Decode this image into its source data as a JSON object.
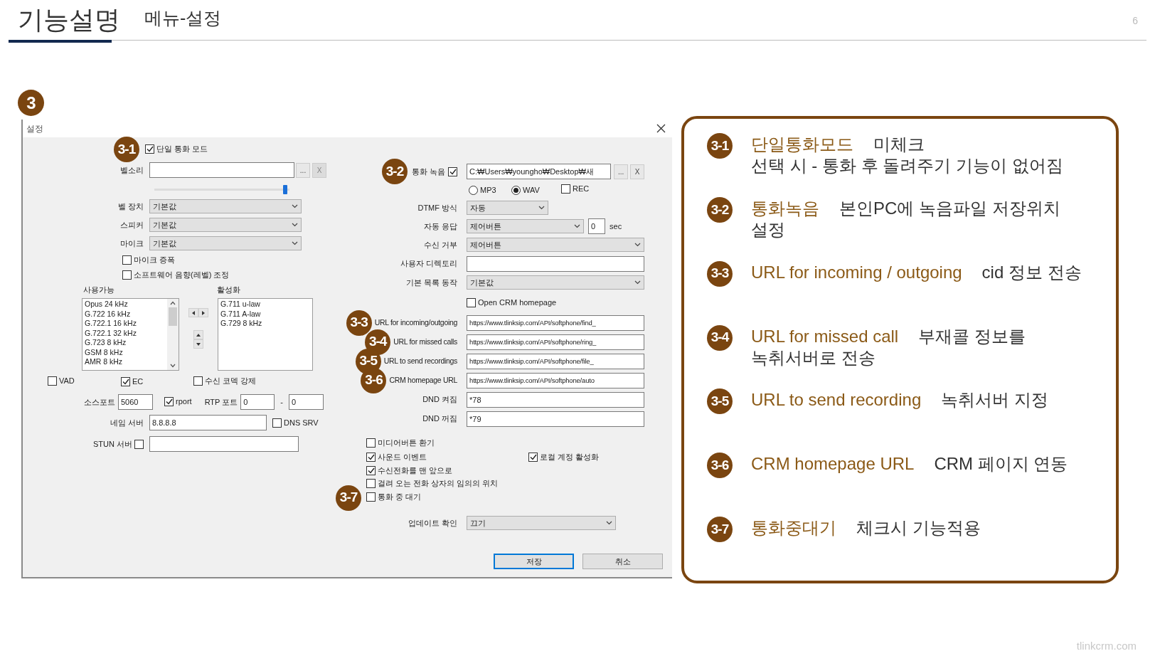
{
  "header": {
    "title": "기능설명",
    "subtitle": "메뉴-설정",
    "page_number": "6"
  },
  "section_badge": "3",
  "dialog": {
    "title": "설정",
    "single_call": {
      "badge": "3-1",
      "label": "단일 통화 모드",
      "checked": true
    },
    "ringtone": {
      "label": "벨소리",
      "browse": "...",
      "clear": "X",
      "volume": {
        "level": 0.97
      }
    },
    "devices": [
      {
        "label": "벨 장치",
        "value": "기본값"
      },
      {
        "label": "스피커",
        "value": "기본값"
      },
      {
        "label": "마이크",
        "value": "기본값"
      }
    ],
    "audio_checks": [
      {
        "label": "마이크 증폭",
        "checked": false
      },
      {
        "label": "소프트웨어 음향(레벨) 조정",
        "checked": false
      }
    ],
    "codecs": {
      "available_label": "사용가능",
      "available": [
        "Opus 24 kHz",
        "G.722 16 kHz",
        "G.722.1 16 kHz",
        "G.722.1 32 kHz",
        "G.723 8 kHz",
        "GSM 8 kHz",
        "AMR 8 kHz"
      ],
      "active_label": "활성화",
      "active": [
        "G.711 u-law",
        "G.711 A-law",
        "G.729 8 kHz"
      ]
    },
    "codec_options": [
      {
        "label": "VAD",
        "checked": false
      },
      {
        "label": "EC",
        "checked": true
      },
      {
        "label": "수신 코덱 강제",
        "checked": false
      }
    ],
    "source_port": {
      "label": "소스포트",
      "value": "5060"
    },
    "rport": {
      "label": "rport",
      "checked": true
    },
    "rtp_port": {
      "label": "RTP 포트",
      "from": "0",
      "separator": "-",
      "to": "0"
    },
    "name_server": {
      "label": "네임 서버",
      "value": "8.8.8.8"
    },
    "dns_srv": {
      "label": "DNS SRV",
      "checked": false
    },
    "stun_server": {
      "label": "STUN 서버",
      "checked": false
    },
    "recording": {
      "badge": "3-2",
      "label": "통화 녹음",
      "checked": true,
      "path": "C:₩Users₩youngho₩Desktop₩새",
      "browse": "...",
      "clear": "X"
    },
    "formats": [
      {
        "label": "MP3",
        "selected": false
      },
      {
        "label": "WAV",
        "selected": true
      }
    ],
    "rec": {
      "label": "REC",
      "checked": false
    },
    "dtmf": {
      "label": "DTMF 방식",
      "value": "자동"
    },
    "auto_answer": {
      "label": "자동 응답",
      "value": "제어버튼",
      "delay": "0",
      "unit": "sec"
    },
    "reject": {
      "label": "수신 거부",
      "value": "제어버튼"
    },
    "user_directory": {
      "label": "사용자 디렉토리"
    },
    "default_list_action": {
      "label": "기본 목록 동작",
      "value": "기본값"
    },
    "open_crm": {
      "label": "Open CRM homepage",
      "checked": false
    },
    "urls": [
      {
        "badge": "3-3",
        "label": "URL for incoming/outgoing",
        "value": "https://www.tlinksip.com/API/softphone/find_"
      },
      {
        "badge": "3-4",
        "label": "URL for missed calls",
        "value": "https://www.tlinksip.com/API/softphone/ring_"
      },
      {
        "badge": "3-5",
        "label": "URL to send recordings",
        "value": "https://www.tlinksip.com/API/softphone/file_"
      },
      {
        "badge": "3-6",
        "label": "CRM homepage URL",
        "value": "https://www.tlinksip.com/API/softphone/auto"
      }
    ],
    "dnd": [
      {
        "label": "DND 켜짐",
        "value": "*78"
      },
      {
        "label": "DND 꺼짐",
        "value": "*79"
      }
    ],
    "option_rows": [
      [
        {
          "label": "미디어버튼 환기",
          "checked": false
        }
      ],
      [
        {
          "label": "사운드 이벤트",
          "checked": true
        },
        {
          "label": "로컬 계정 활성화",
          "checked": true
        }
      ],
      [
        {
          "label": "수신전화를 맨 앞으로",
          "checked": true
        }
      ],
      [
        {
          "label": "걸려 오는 전화 상자의 임의의 위치",
          "checked": false
        }
      ],
      [
        {
          "label": "통화 중 대기",
          "checked": false,
          "badge": "3-7"
        }
      ]
    ],
    "update_check": {
      "label": "업데이트 확인",
      "value": "끄기"
    },
    "buttons": [
      {
        "label": "저장",
        "default": true
      },
      {
        "label": "취소",
        "default": false
      }
    ]
  },
  "notes": [
    {
      "badge": "3-1",
      "title": "단일통화모드",
      "text": "미체크",
      "line2": "선택 시 - 통화 후 돌려주기 기능이 없어짐"
    },
    {
      "badge": "3-2",
      "title": "통화녹음",
      "text": "본인PC에 녹음파일 저장위치",
      "line2": "설정"
    },
    {
      "badge": "3-3",
      "title": "URL for incoming / outgoing",
      "text": "cid 정보 전송"
    },
    {
      "badge": "3-4",
      "title": "URL for missed call",
      "text": "부재콜 정보를",
      "line2": "녹취서버로 전송"
    },
    {
      "badge": "3-5",
      "title": "URL to send recording",
      "text": "녹취서버 지정"
    },
    {
      "badge": "3-6",
      "title": "CRM homepage URL",
      "text": "CRM 페이지 연동"
    },
    {
      "badge": "3-7",
      "title": "통화중대기",
      "text": "체크시 기능적용"
    }
  ],
  "footer": "tlinkcrm.com"
}
